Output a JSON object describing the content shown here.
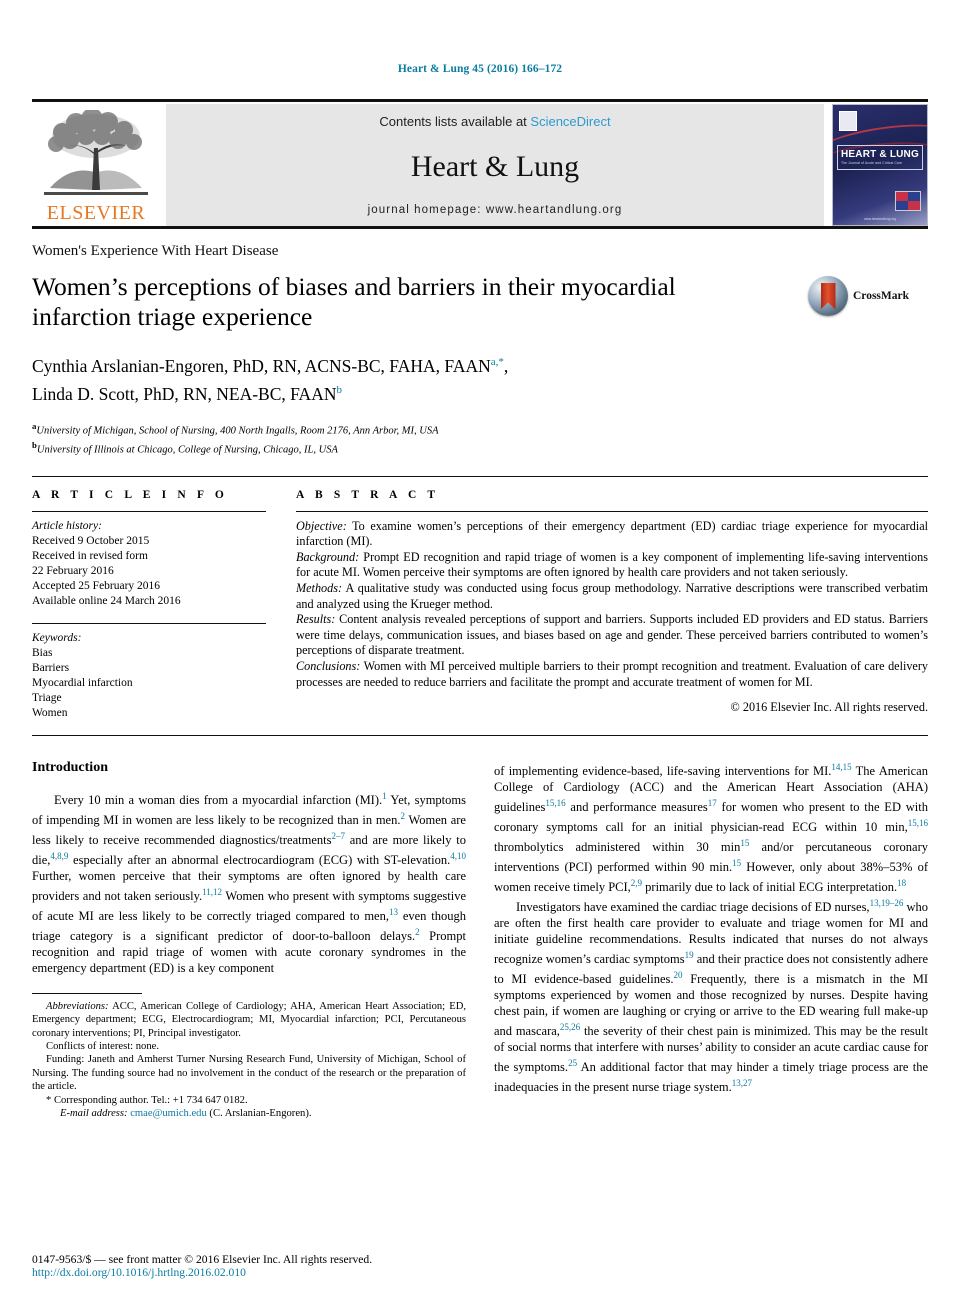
{
  "running_head": "Heart & Lung 45 (2016) 166–172",
  "masthead": {
    "contents_prefix": "Contents lists available at ",
    "sciencedirect": "ScienceDirect",
    "journal_name": "Heart & Lung",
    "homepage": "journal homepage: www.heartandlung.org",
    "publisher": "ELSEVIER",
    "cover": {
      "title": "HEART & LUNG",
      "subtitle": "The Journal of Acute and Critical Care",
      "url": "www.heartandlung.org"
    }
  },
  "article_type": "Women's Experience With Heart Disease",
  "title": "Women’s perceptions of biases and barriers in their myocardial infarction triage experience",
  "crossmark_label": "CrossMark",
  "authors": [
    {
      "name": "Cynthia Arslanian-Engoren, PhD, RN, ACNS-BC, FAHA, FAAN",
      "marks": "a,*",
      "trailing": ","
    },
    {
      "name": "Linda D. Scott, PhD, RN, NEA-BC, FAAN",
      "marks": "b",
      "trailing": ""
    }
  ],
  "affiliations": [
    {
      "mark": "a",
      "text": "University of Michigan, School of Nursing, 400 North Ingalls, Room 2176, Ann Arbor, MI, USA"
    },
    {
      "mark": "b",
      "text": "University of Illinois at Chicago, College of Nursing, Chicago, IL, USA"
    }
  ],
  "article_info": {
    "label": "A R T I C L E    I N F O",
    "history_title": "Article history:",
    "history": [
      "Received 9 October 2015",
      "Received in revised form",
      "22 February 2016",
      "Accepted 25 February 2016",
      "Available online 24 March 2016"
    ],
    "keywords_title": "Keywords:",
    "keywords": [
      "Bias",
      "Barriers",
      "Myocardial infarction",
      "Triage",
      "Women"
    ]
  },
  "abstract": {
    "label": "A B S T R A C T",
    "sections": [
      {
        "head": "Objective:",
        "text": " To examine women’s perceptions of their emergency department (ED) cardiac triage experience for myocardial infarction (MI)."
      },
      {
        "head": "Background:",
        "text": " Prompt ED recognition and rapid triage of women is a key component of implementing life-saving interventions for acute MI. Women perceive their symptoms are often ignored by health care providers and not taken seriously."
      },
      {
        "head": "Methods:",
        "text": " A qualitative study was conducted using focus group methodology. Narrative descriptions were transcribed verbatim and analyzed using the Krueger method."
      },
      {
        "head": "Results:",
        "text": " Content analysis revealed perceptions of support and barriers. Supports included ED providers and ED status. Barriers were time delays, communication issues, and biases based on age and gender. These perceived barriers contributed to women’s perceptions of disparate treatment."
      },
      {
        "head": "Conclusions:",
        "text": " Women with MI perceived multiple barriers to their prompt recognition and treatment. Evaluation of care delivery processes are needed to reduce barriers and facilitate the prompt and accurate treatment of women for MI."
      }
    ],
    "copyright": "© 2016 Elsevier Inc. All rights reserved."
  },
  "body": {
    "intro_heading": "Introduction",
    "left_paragraphs": [
      "Every 10 min a woman dies from a myocardial infarction (MI).^1^ Yet, symptoms of impending MI in women are less likely to be recognized than in men.^2^ Women are less likely to receive recommended diagnostics/treatments^2–7^ and are more likely to die,^4,8,9^ especially after an abnormal electrocardiogram (ECG) with ST-elevation.^4,10^ Further, women perceive that their symptoms are often ignored by health care providers and not taken seriously.^11,12^ Women who present with symptoms suggestive of acute MI are less likely to be correctly triaged compared to men,^13^ even though triage category is a significant predictor of door-to-balloon delays.^2^ Prompt recognition and rapid triage of women with acute coronary syndromes in the emergency department (ED) is a key component"
    ],
    "right_paragraphs": [
      "of implementing evidence-based, life-saving interventions for MI.^14,15^ The American College of Cardiology (ACC) and the American Heart Association (AHA) guidelines^15,16^ and performance measures^17^ for women who present to the ED with coronary symptoms call for an initial physician-read ECG within 10 min,^15,16^ thrombolytics administered within 30 min^15^ and/or percutaneous coronary interventions (PCI) performed within 90 min.^15^ However, only about 38%–53% of women receive timely PCI,^2,9^ primarily due to lack of initial ECG interpretation.^18^",
      "Investigators have examined the cardiac triage decisions of ED nurses,^13,19–26^ who are often the first health care provider to evaluate and triage women for MI and initiate guideline recommendations. Results indicated that nurses do not always recognize women’s cardiac symptoms^19^ and their practice does not consistently adhere to MI evidence-based guidelines.^20^ Frequently, there is a mismatch in the MI symptoms experienced by women and those recognized by nurses. Despite having chest pain, if women are laughing or crying or arrive to the ED wearing full make-up and mascara,^25,26^ the severity of their chest pain is minimized. This may be the result of social norms that interfere with nurses’ ability to consider an acute cardiac cause for the symptoms.^25^ An additional factor that may hinder a timely triage process are the inadequacies in the present nurse triage system.^13,27^"
    ]
  },
  "footnotes": {
    "abbreviations_label": "Abbreviations:",
    "abbreviations_text": " ACC, American College of Cardiology; AHA, American Heart Association; ED, Emergency department; ECG, Electrocardiogram; MI, Myocardial infarction; PCI, Percutaneous coronary interventions; PI, Principal investigator.",
    "conflicts": "Conflicts of interest: none.",
    "funding": "Funding: Janeth and Amherst Turner Nursing Research Fund, University of Michigan, School of Nursing. The funding source had no involvement in the conduct of the research or the preparation of the article.",
    "corresponding": "* Corresponding author. Tel.: +1 734 647 0182.",
    "email_label": "E-mail address:",
    "email": "cmae@umich.edu",
    "email_suffix": " (C. Arslanian-Engoren)."
  },
  "footer": {
    "issn_line": "0147-9563/$ — see front matter © 2016 Elsevier Inc. All rights reserved.",
    "doi": "http://dx.doi.org/10.1016/j.hrtlng.2016.02.010"
  },
  "colors": {
    "link": "#0b7ba3",
    "elsevier_orange": "#E87722",
    "sciencedirect_blue": "#2e9ad0",
    "masthead_gray": "#e6e6e6"
  }
}
